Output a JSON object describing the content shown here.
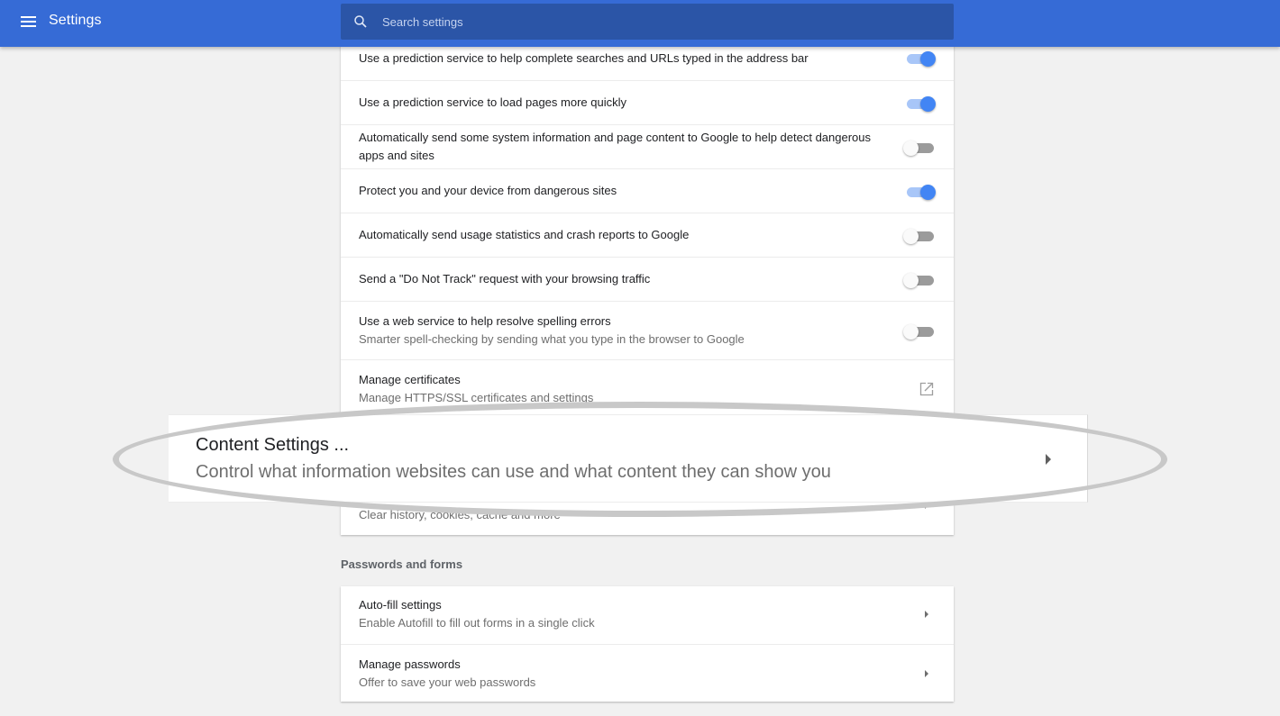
{
  "header": {
    "title": "Settings",
    "search_placeholder": "Search settings"
  },
  "colors": {
    "header_bg": "#366bd6",
    "search_bg": "#2b55a7",
    "toggle_on": "#4285f4",
    "page_bg": "#f1f1f1"
  },
  "privacy": {
    "rows": [
      {
        "label": "Use a prediction service to help complete searches and URLs typed in the address bar",
        "toggle": true
      },
      {
        "label": "Use a prediction service to load pages more quickly",
        "toggle": true
      },
      {
        "label": "Automatically send some system information and page content to Google to help detect dangerous apps and sites",
        "toggle": false
      },
      {
        "label": "Protect you and your device from dangerous sites",
        "toggle": true
      },
      {
        "label": "Automatically send usage statistics and crash reports to Google",
        "toggle": false
      },
      {
        "label": "Send a \"Do Not Track\" request with your browsing traffic",
        "toggle": false
      },
      {
        "label": "Use a web service to help resolve spelling errors",
        "sublabel": "Smarter spell-checking by sending what you type in the browser to Google",
        "toggle": false
      }
    ],
    "manage_certificates": {
      "label": "Manage certificates",
      "sublabel": "Manage HTTPS/SSL certificates and settings",
      "icon": "external-link-icon"
    },
    "clear_browsing": {
      "sublabel": "Clear history, cookies, cache and more"
    }
  },
  "callout": {
    "title": "Content Settings ...",
    "subtitle": "Control what information websites can use and what content they can show you"
  },
  "passwords_section": {
    "title": "Passwords and forms",
    "rows": [
      {
        "label": "Auto-fill settings",
        "sublabel": "Enable Autofill to fill out forms in a single click"
      },
      {
        "label": "Manage passwords",
        "sublabel": "Offer to save your web passwords"
      }
    ]
  }
}
